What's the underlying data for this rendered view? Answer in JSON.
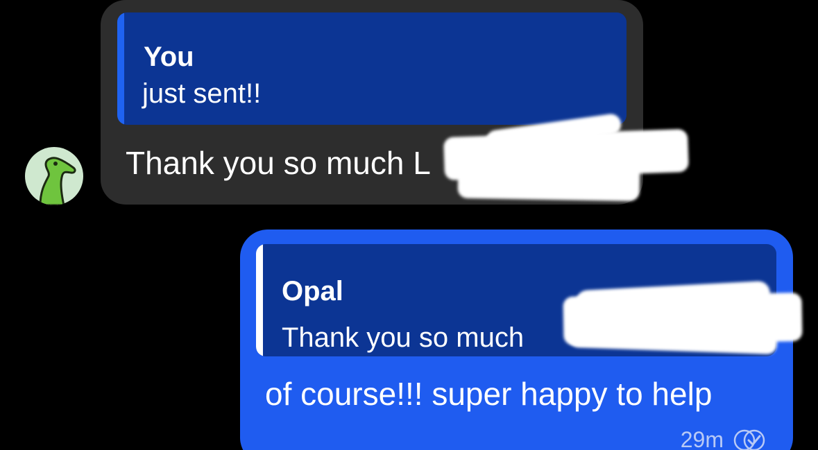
{
  "incoming": {
    "quote_author": "You",
    "quote_text": "just sent!!",
    "message": "Thank you so much L"
  },
  "outgoing": {
    "quote_author": "Opal",
    "quote_text": "Thank you so much",
    "message": "of course!!! super happy to help",
    "time": "29m",
    "status_icon": "read-check-icon"
  },
  "colors": {
    "background": "#000000",
    "incoming_bubble": "#2d2d2d",
    "outgoing_bubble": "#1f5cf0",
    "quote_bg": "#0c3594",
    "accent": "#1f63f2"
  }
}
